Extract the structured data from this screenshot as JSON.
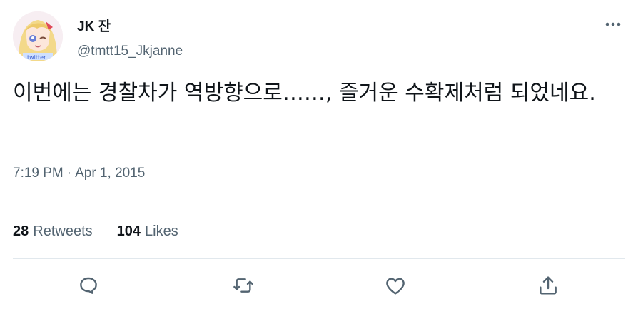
{
  "user": {
    "display_name": "JK 잔",
    "handle": "@tmtt15_Jkjanne",
    "avatar_icon": "avatar-anime-girl"
  },
  "tweet": {
    "text": "이번에는 경찰차가 역방향으로……, 즐거운 수확제처럼 되었네요.",
    "time": "7:19 PM",
    "separator": "·",
    "date": "Apr 1, 2015"
  },
  "stats": {
    "retweets_count": "28",
    "retweets_label": "Retweets",
    "likes_count": "104",
    "likes_label": "Likes"
  },
  "actions": [
    "reply-icon",
    "retweet-icon",
    "like-icon",
    "share-icon"
  ],
  "colors": {
    "text_primary": "#0f1419",
    "text_secondary": "#536471",
    "divider": "#e1e8ed"
  }
}
